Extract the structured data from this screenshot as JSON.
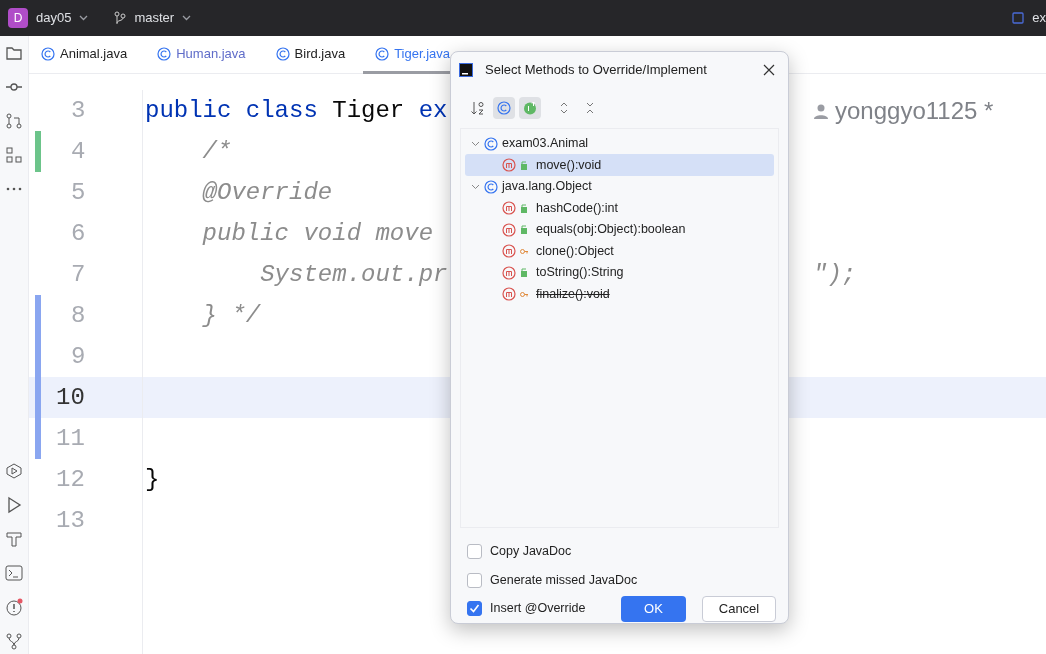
{
  "topbar": {
    "project_badge": "D",
    "project": "day05",
    "branch": "master",
    "right_text": "ex"
  },
  "tabs": [
    {
      "label": "Animal.java",
      "selected": false,
      "modified": false
    },
    {
      "label": "Human.java",
      "selected": false,
      "modified": true
    },
    {
      "label": "Bird.java",
      "selected": false,
      "modified": false
    },
    {
      "label": "Tiger.java",
      "selected": true,
      "modified": false
    }
  ],
  "editor": {
    "lines": [
      {
        "number": "3",
        "current": false,
        "added": false,
        "modified": false,
        "tokens": [
          {
            "kind": "keyword",
            "text": "public class "
          },
          {
            "kind": "plain",
            "text": "Tiger "
          },
          {
            "kind": "keyword",
            "text": "ex"
          }
        ],
        "author": "yonggyo1125 *"
      },
      {
        "number": "4",
        "current": false,
        "added": true,
        "modified": false,
        "tokens": [
          {
            "kind": "comment",
            "text": "    /*"
          }
        ]
      },
      {
        "number": "5",
        "current": false,
        "added": false,
        "modified": false,
        "tokens": [
          {
            "kind": "comment",
            "text": "    @Override"
          }
        ]
      },
      {
        "number": "6",
        "current": false,
        "added": false,
        "modified": false,
        "tokens": [
          {
            "kind": "comment",
            "text": "    public void move"
          }
        ]
      },
      {
        "number": "7",
        "current": false,
        "added": false,
        "modified": false,
        "tokens": [
          {
            "kind": "comment",
            "text": "        System.out.pr"
          }
        ],
        "right": "\");"
      },
      {
        "number": "8",
        "current": false,
        "added": false,
        "modified": true,
        "tokens": [
          {
            "kind": "comment",
            "text": "    } */"
          }
        ]
      },
      {
        "number": "9",
        "current": false,
        "added": false,
        "modified": true
      },
      {
        "number": "10",
        "current": true,
        "added": false,
        "modified": true
      },
      {
        "number": "11",
        "current": false,
        "added": false,
        "modified": true
      },
      {
        "number": "12",
        "current": false,
        "added": false,
        "modified": false,
        "tokens": [
          {
            "kind": "plain",
            "text": "}"
          }
        ]
      },
      {
        "number": "13",
        "current": false,
        "added": false,
        "modified": false
      }
    ]
  },
  "dialog": {
    "title": "Select Methods to Override/Implement",
    "toolbar": [
      {
        "kind": "sort",
        "selected": false
      },
      {
        "kind": "class",
        "selected": true
      },
      {
        "kind": "inherited",
        "selected": true
      },
      {
        "kind": "expand",
        "selected": false
      },
      {
        "kind": "collapse",
        "selected": false
      }
    ],
    "tree": [
      {
        "label": "exam03.Animal",
        "expanded": true,
        "children": [
          {
            "label": "move():void",
            "kind": "public",
            "deprecated": false,
            "selected": true
          }
        ]
      },
      {
        "label": "java.lang.Object",
        "expanded": true,
        "children": [
          {
            "label": "hashCode():int",
            "kind": "public",
            "deprecated": false,
            "selected": false
          },
          {
            "label": "equals(obj:Object):boolean",
            "kind": "public",
            "deprecated": false,
            "selected": false
          },
          {
            "label": "clone():Object",
            "kind": "protected",
            "deprecated": false,
            "selected": false
          },
          {
            "label": "toString():String",
            "kind": "public",
            "deprecated": false,
            "selected": false
          },
          {
            "label": "finalize():void",
            "kind": "protected",
            "deprecated": true,
            "selected": false
          }
        ]
      }
    ],
    "options": [
      {
        "label": "Copy JavaDoc",
        "checked": false
      },
      {
        "label": "Generate missed JavaDoc",
        "checked": false
      },
      {
        "label": "Insert @Override",
        "checked": true
      }
    ],
    "buttons": [
      {
        "label": "OK",
        "kind": "primary"
      },
      {
        "label": "Cancel",
        "kind": "secondary"
      }
    ]
  }
}
